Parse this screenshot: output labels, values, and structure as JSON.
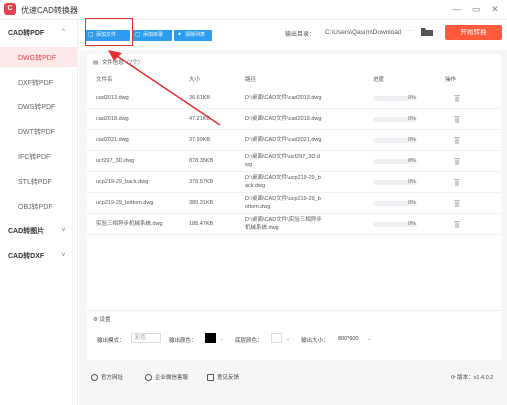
{
  "app": {
    "title": "优速CAD转换器",
    "logo_char": "C"
  },
  "window": {
    "minimize": "—",
    "restore": "▭",
    "close": "✕"
  },
  "sidebar": {
    "categories": [
      {
        "label": "CAD转PDF",
        "chevron": "^"
      },
      {
        "label": "CAD转图片",
        "chevron": "v"
      },
      {
        "label": "CAD转DXF",
        "chevron": "v"
      }
    ],
    "items": [
      {
        "label": "DWG转PDF",
        "active": true
      },
      {
        "label": "DXF转PDF",
        "active": false
      },
      {
        "label": "DWS转PDF",
        "active": false
      },
      {
        "label": "DWT转PDF",
        "active": false
      },
      {
        "label": "IFC转PDF",
        "active": false
      },
      {
        "label": "STL转PDF",
        "active": false
      },
      {
        "label": "OBJ转PDF",
        "active": false
      }
    ]
  },
  "toolbar": {
    "add_file": "添加文件",
    "add_folder": "添加目录",
    "clear_list": "清除列表",
    "output_dir_label": "输出目录：",
    "output_dir_value": "C:\\Users\\Qasim\\Downloads",
    "more": "···",
    "start": "开始转换"
  },
  "files": {
    "title": "文件信息（7个）",
    "columns": [
      "文件名",
      "大小",
      "路径",
      "进度",
      "操作"
    ],
    "rows": [
      {
        "name": "cad2013.dwg",
        "size": "36.61KB",
        "path1": "D:\\桌面\\CAD文件\\cad2013.dwg",
        "path2": "",
        "progress": "0%"
      },
      {
        "name": "cad2018.dwg",
        "size": "47.21KB",
        "path1": "D:\\桌面\\CAD文件\\cad2018.dwg",
        "path2": "",
        "progress": "0%"
      },
      {
        "name": "cad2021.dwg",
        "size": "37.99KB",
        "path1": "D:\\桌面\\CAD文件\\cad2021.dwg",
        "path2": "",
        "progress": "0%"
      },
      {
        "name": "ucf297_3D.dwg",
        "size": "878.35KB",
        "path1": "D:\\桌面\\CAD文件\\ucf297_3D.d",
        "path2": "wg",
        "progress": "0%"
      },
      {
        "name": "ucp219-29_back.dwg",
        "size": "378.57KB",
        "path1": "D:\\桌面\\CAD文件\\ucp219-29_b",
        "path2": "ack.dwg",
        "progress": "0%"
      },
      {
        "name": "ucp219-29_bottom.dwg",
        "size": "380.31KB",
        "path1": "D:\\桌面\\CAD文件\\ucp219-29_b",
        "path2": "ottom.dwg",
        "progress": "0%"
      },
      {
        "name": "实验三相异步机械系统.dwg",
        "size": "188.47KB",
        "path1": "D:\\桌面\\CAD文件\\实验三相异步",
        "path2": "机械系统.dwg",
        "progress": "0%"
      }
    ]
  },
  "settings": {
    "title": "设置",
    "output_mode_label": "输出模式：",
    "output_mode_value": "彩色",
    "output_color_label": "输出颜色：",
    "output_color_value": "#000000",
    "bg_color_label": "底层颜色：",
    "output_size_label": "输出大小：",
    "output_size_value": "800*600"
  },
  "footer": {
    "website": "官方网址",
    "service": "企业微信客服",
    "feedback": "意见反馈",
    "version": "版本：v1.4.0.2"
  },
  "colors": {
    "accent": "#2b9cf0",
    "brand": "#e6404e",
    "start": "#ff5a3c"
  }
}
